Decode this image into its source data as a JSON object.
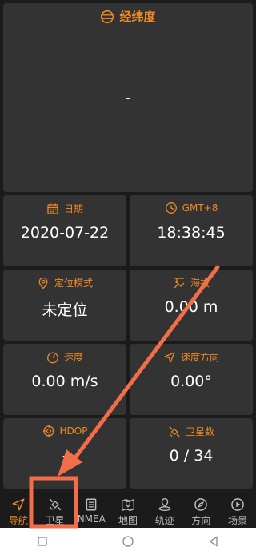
{
  "latlon": {
    "title": "经纬度",
    "value": "-"
  },
  "date": {
    "title": "日期",
    "value": "2020-07-22"
  },
  "time": {
    "title": "GMT+8",
    "value": "18:38:45"
  },
  "mode": {
    "title": "定位模式",
    "value": "未定位"
  },
  "altitude": {
    "title": "海拔",
    "value": "0.00 m"
  },
  "speed": {
    "title": "速度",
    "value": "0.00 m/s"
  },
  "heading": {
    "title": "速度方向",
    "value": "0.00°"
  },
  "hdop": {
    "title": "HDOP",
    "value": "-"
  },
  "satcount": {
    "title": "卫星数",
    "value": "0 / 34"
  },
  "nav": [
    {
      "label": "导航",
      "icon": "navigation-arrow-icon"
    },
    {
      "label": "卫星",
      "icon": "satellite-icon"
    },
    {
      "label": "NMEA",
      "icon": "document-icon"
    },
    {
      "label": "地图",
      "icon": "map-pin-icon"
    },
    {
      "label": "轨迹",
      "icon": "track-pin-icon"
    },
    {
      "label": "方向",
      "icon": "compass-icon"
    },
    {
      "label": "场景",
      "icon": "play-icon"
    }
  ],
  "colors": {
    "accent": "#ef8a24",
    "background": "#1b1b1b",
    "card": "#333333",
    "annotation": "#f26d4a"
  }
}
